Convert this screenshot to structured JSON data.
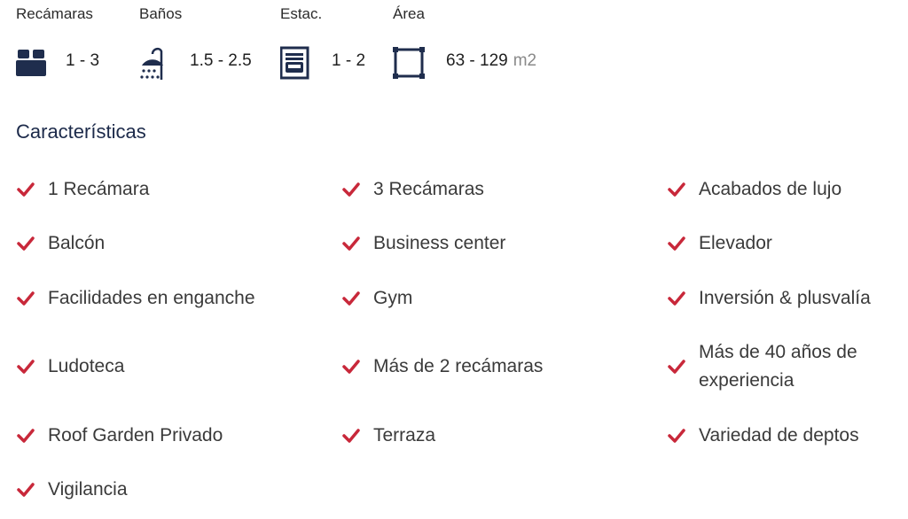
{
  "stats": {
    "bedrooms": {
      "label": "Recámaras",
      "value": "1 - 3",
      "icon": "bed-icon"
    },
    "baths": {
      "label": "Baños",
      "value": "1.5 - 2.5",
      "icon": "shower-icon"
    },
    "parking": {
      "label": "Estac.",
      "value": "1 - 2",
      "icon": "garage-icon"
    },
    "area": {
      "label": "Área",
      "value": "63 - 129",
      "unit": "m2",
      "icon": "area-square-icon"
    }
  },
  "features_title": "Características",
  "features": [
    "1 Recámara",
    "3 Recámaras",
    "Acabados de lujo",
    "Balcón",
    "Business center",
    "Elevador",
    "Facilidades en enganche",
    "Gym",
    "Inversión & plusvalía",
    "Ludoteca",
    "Más de 2 recámaras",
    "Más de 40 años de experiencia",
    "Roof Garden Privado",
    "Terraza",
    "Variedad de deptos",
    "Vigilancia"
  ],
  "colors": {
    "check": "#c8283a",
    "icon": "#1f2d4d",
    "title": "#1c2a4a"
  }
}
